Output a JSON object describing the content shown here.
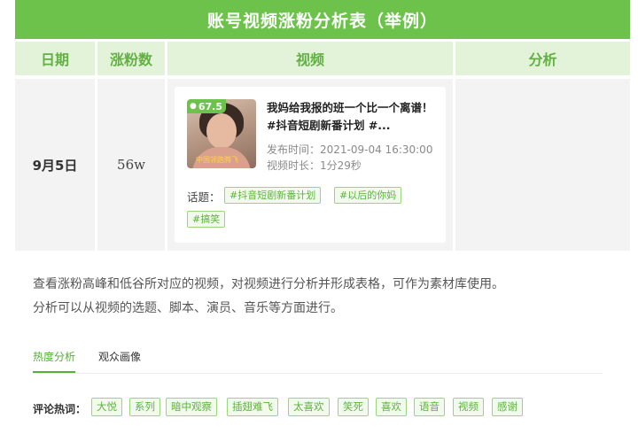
{
  "table": {
    "title": "账号视频涨粉分析表（举例）",
    "headers": {
      "date": "日期",
      "fans": "涨粉数",
      "video": "视频",
      "analysis": "分析"
    },
    "row": {
      "date": "9月5日",
      "fans": "56w",
      "video": {
        "score": "67.5",
        "thumb_caption": "中国领跑腾飞",
        "title": "我妈给我报的班一个比一个离谱！#抖音短剧新番计划 #...",
        "publish_time": "发布时间：2021-09-04 16:30:00",
        "duration": "视频时长：1分29秒",
        "topics_label": "话题：",
        "topics": [
          "#抖音短剧新番计划",
          "#以后的你妈",
          "#搞笑"
        ]
      },
      "analysis": ""
    }
  },
  "description": {
    "line1": "查看涨粉高峰和低谷所对应的视频，对视频进行分析并形成表格，可作为素材库使用。",
    "line2": "分析可以从视频的选题、脚本、演员、音乐等方面进行。"
  },
  "tabs": [
    {
      "label": "热度分析",
      "active": true
    },
    {
      "label": "观众画像",
      "active": false
    }
  ],
  "hot_words": {
    "label": "评论热词：",
    "words": [
      "大悦",
      "系列",
      "暗中观察",
      "插翅难飞",
      "太喜欢",
      "笑死",
      "喜欢",
      "语音",
      "视频",
      "感谢"
    ]
  },
  "colors": {
    "accent": "#6cc24a",
    "header_bg": "#e3f3d9",
    "cell_bg": "#f3f3f3"
  }
}
